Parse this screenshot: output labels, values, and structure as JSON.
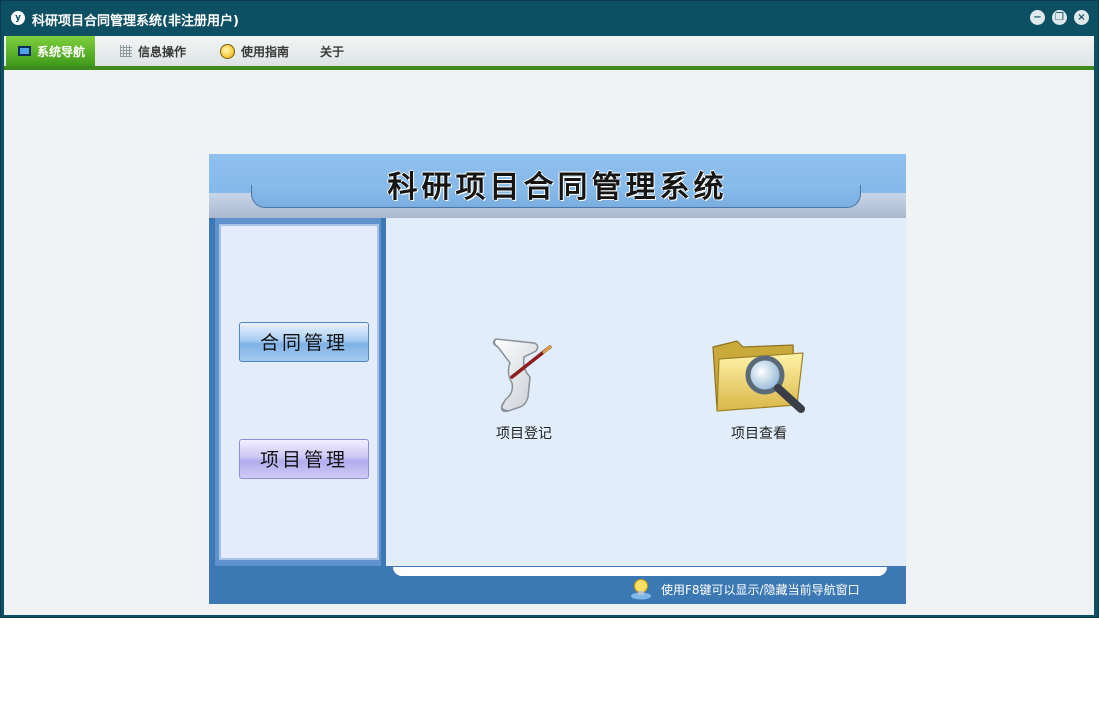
{
  "window": {
    "title": "科研项目合同管理系统(非注册用户)",
    "app_icon_letter": "y",
    "minimize_glyph": "−",
    "restore_glyph": "❐",
    "close_glyph": "×"
  },
  "menu": {
    "items": [
      {
        "label": "系统导航",
        "icon": "monitor-icon",
        "active": true
      },
      {
        "label": "信息操作",
        "icon": "grid-icon",
        "active": false
      },
      {
        "label": "使用指南",
        "icon": "bulb-icon",
        "active": false
      },
      {
        "label": "关于",
        "icon": "",
        "active": false
      }
    ]
  },
  "panel": {
    "title": "科研项目合同管理系统",
    "sidebar_buttons": [
      {
        "label": "合同管理"
      },
      {
        "label": "项目管理"
      }
    ],
    "tiles": [
      {
        "label": "项目登记",
        "icon": "scroll-quill-icon"
      },
      {
        "label": "项目查看",
        "icon": "folder-search-icon"
      }
    ],
    "footer_hint": "使用F8键可以显示/隐藏当前导航窗口",
    "footer_icon": "lightbulb-icon"
  },
  "colors": {
    "titlebar": "#0d4f63",
    "menu_active": "#5aa82a",
    "panel_border": "#3c79b4",
    "header": "#8fc0ee",
    "main_bg": "#e2edfb"
  }
}
